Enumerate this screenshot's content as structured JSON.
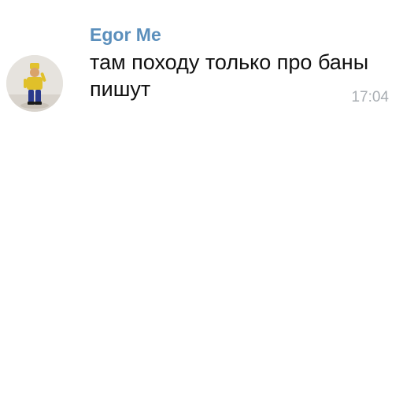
{
  "message": {
    "sender": "Egor Me",
    "text": "там походу только про баны пишут",
    "time": "17:04",
    "avatar": "profile-photo-figurine"
  },
  "colors": {
    "sender": "#5b8fbc",
    "text": "#111111",
    "time": "#a8adb2",
    "background": "#ffffff"
  }
}
